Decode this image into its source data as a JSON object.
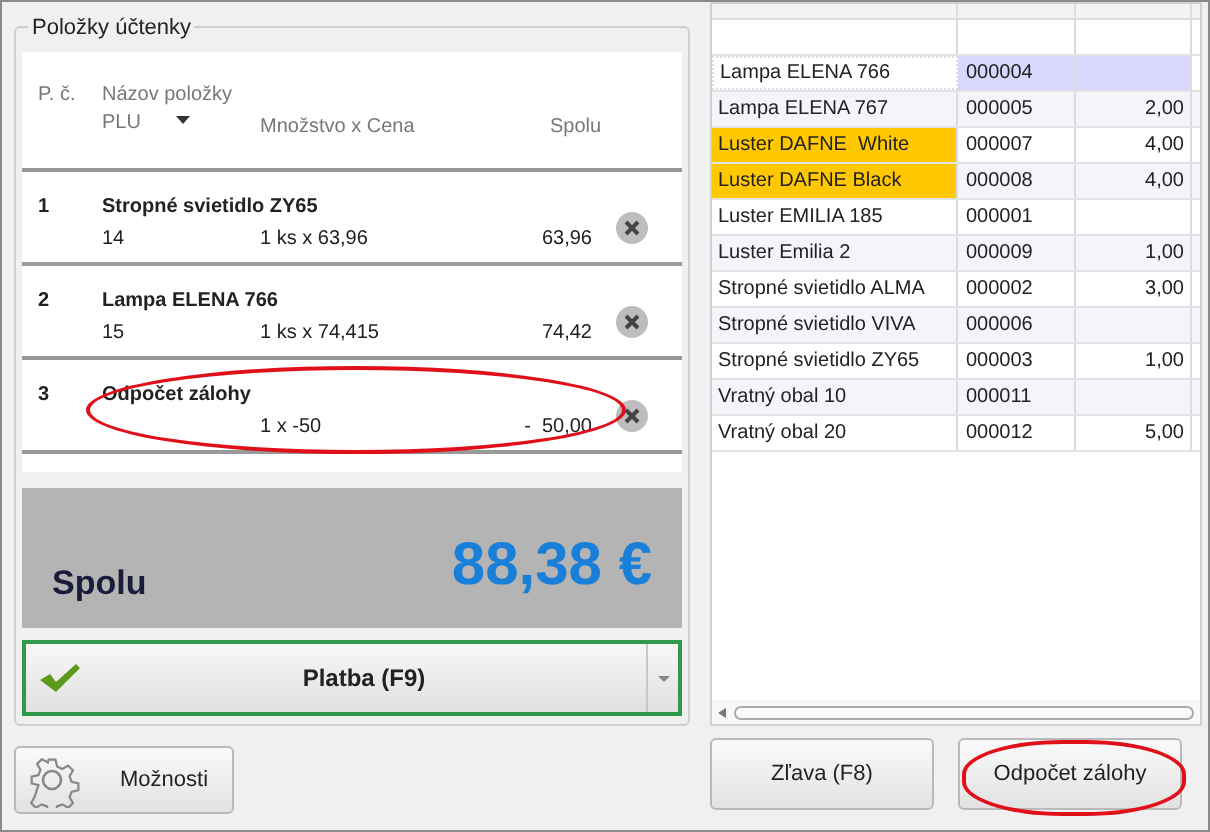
{
  "receipt": {
    "title": "Položky účtenky",
    "headers": {
      "number": "P. č.",
      "name": "Názov položky",
      "plu": "PLU",
      "quantity": "Množstvo x Cena",
      "total": "Spolu"
    },
    "items": [
      {
        "number": "1",
        "name": "Stropné svietidlo ZY65",
        "plu": "14",
        "quantity": "1 ks x 63,96",
        "total": "63,96",
        "circled": false
      },
      {
        "number": "2",
        "name": "Lampa ELENA 766",
        "plu": "15",
        "quantity": "1 ks x 74,415",
        "total": "74,42",
        "circled": false
      },
      {
        "number": "3",
        "name": "Odpočet zálohy",
        "quantity": "1  x -50",
        "total": "-  50,00",
        "circled": true
      }
    ],
    "total_label": "Spolu",
    "total_value": "88,38 €",
    "pay_button": "Platba (F9)"
  },
  "options_button": "Možnosti",
  "products": [
    {
      "name": "Lampa ELENA 766",
      "code": "000004",
      "selected": true,
      "flagged": false
    },
    {
      "name": "Lampa ELENA 767",
      "code": "000005",
      "stock": "2,00",
      "selected": false,
      "flagged": false
    },
    {
      "name": "Luster DAFNE  White",
      "code": "000007",
      "stock": "4,00",
      "selected": false,
      "flagged": true
    },
    {
      "name": "Luster DAFNE Black",
      "code": "000008",
      "stock": "4,00",
      "selected": false,
      "flagged": true
    },
    {
      "name": "Luster EMILIA 185",
      "code": "000001",
      "selected": false,
      "flagged": false
    },
    {
      "name": "Luster Emilia 2",
      "code": "000009",
      "stock": "1,00",
      "selected": false,
      "flagged": false
    },
    {
      "name": "Stropné svietidlo ALMA",
      "code": "000002",
      "stock": "3,00",
      "selected": false,
      "flagged": false
    },
    {
      "name": "Stropné svietidlo VIVA",
      "code": "000006",
      "selected": false,
      "flagged": false
    },
    {
      "name": "Stropné svietidlo ZY65",
      "code": "000003",
      "stock": "1,00",
      "selected": false,
      "flagged": false
    },
    {
      "name": "Vratný obal 10",
      "code": "000011",
      "selected": false,
      "flagged": false
    },
    {
      "name": "Vratný obal 20",
      "code": "000012",
      "stock": "5,00",
      "selected": false,
      "flagged": false
    }
  ],
  "bottom_buttons": [
    {
      "label": "Zľava (F8)",
      "circled": false
    },
    {
      "label": "Odpočet zálohy",
      "circled": true
    }
  ]
}
